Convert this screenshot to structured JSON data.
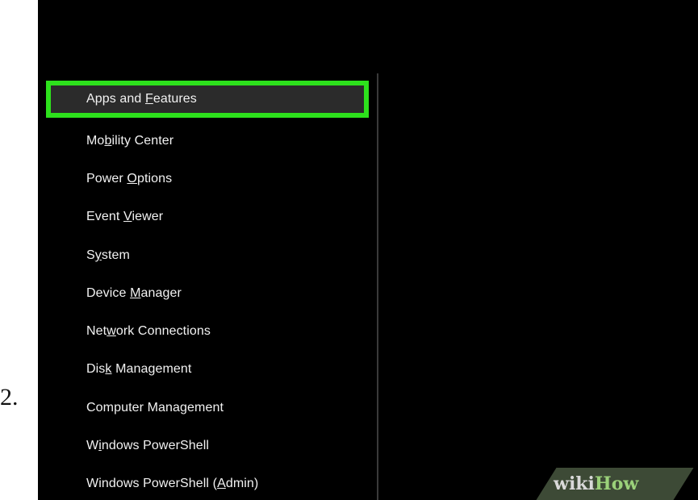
{
  "step": {
    "number": "2."
  },
  "menu": {
    "highlight_color": "#2de11c",
    "items": [
      {
        "pre": "Apps and ",
        "key": "F",
        "post": "eatures",
        "highlighted": true
      },
      {
        "pre": "Mo",
        "key": "b",
        "post": "ility Center",
        "highlighted": false
      },
      {
        "pre": "Power ",
        "key": "O",
        "post": "ptions",
        "highlighted": false
      },
      {
        "pre": "Event ",
        "key": "V",
        "post": "iewer",
        "highlighted": false
      },
      {
        "pre": "S",
        "key": "y",
        "post": "stem",
        "highlighted": false
      },
      {
        "pre": "Device ",
        "key": "M",
        "post": "anager",
        "highlighted": false
      },
      {
        "pre": "Net",
        "key": "w",
        "post": "ork Connections",
        "highlighted": false
      },
      {
        "pre": "Dis",
        "key": "k",
        "post": " Management",
        "highlighted": false
      },
      {
        "pre": "Computer Mana",
        "key": "g",
        "post": "ement",
        "highlighted": false
      },
      {
        "pre": "W",
        "key": "i",
        "post": "ndows PowerShell",
        "highlighted": false
      },
      {
        "pre": "Windows PowerShell (",
        "key": "A",
        "post": "dmin)",
        "highlighted": false
      }
    ]
  },
  "watermark": {
    "wiki": "wiki",
    "how": "How"
  }
}
